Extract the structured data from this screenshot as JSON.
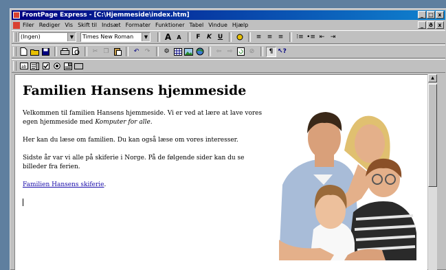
{
  "window": {
    "title": "FrontPage Express - [C:\\Hjemmeside\\index.htm]",
    "min_glyph": "_",
    "max_glyph": "□",
    "close_glyph": "x",
    "restore_glyph": "ð"
  },
  "menu": {
    "items": [
      "Filer",
      "Rediger",
      "Vis",
      "Skift til",
      "Indsæt",
      "Formater",
      "Funktioner",
      "Tabel",
      "Vindue",
      "Hjælp"
    ]
  },
  "toolbar1": {
    "style_value": "(Ingen)",
    "font_value": "Times New Roman",
    "bold": "F",
    "italic": "K",
    "underline": "U"
  },
  "document": {
    "heading": "Familien Hansens hjemmeside",
    "para1_normal": "Velkommen til familien Hansens hjemmeside. Vi er ved at lære at lave vores egen hjemmeside med ",
    "para1_italic": "Komputer for alle",
    "para1_end": ".",
    "para2": "Her kan du læse om familien. Du kan også læse om vores interesser.",
    "para3": "Sidste år var vi alle på skiferie i Norge. På de følgende sider kan du se billeder fra ferien.",
    "link": "Familien Hansens skiferie",
    "link_end": "."
  },
  "colors": {
    "titlebar": "#000080",
    "link": "#1a0dab",
    "chrome": "#c0c0c0"
  }
}
